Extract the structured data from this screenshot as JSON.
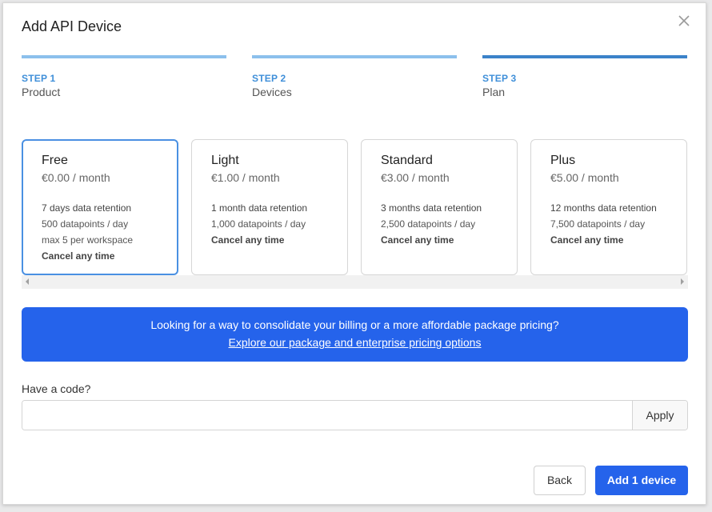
{
  "dialog": {
    "title": "Add API Device"
  },
  "steps": [
    {
      "num": "STEP 1",
      "name": "Product"
    },
    {
      "num": "STEP 2",
      "name": "Devices"
    },
    {
      "num": "STEP 3",
      "name": "Plan"
    }
  ],
  "plans": [
    {
      "name": "Free",
      "price": "€0.00 / month",
      "features": [
        "7 days data retention",
        "500 datapoints / day",
        "max 5 per workspace",
        "Cancel any time"
      ],
      "selected": true
    },
    {
      "name": "Light",
      "price": "€1.00 / month",
      "features": [
        "1 month data retention",
        "1,000 datapoints / day",
        "Cancel any time"
      ]
    },
    {
      "name": "Standard",
      "price": "€3.00 / month",
      "features": [
        "3 months data retention",
        "2,500 datapoints / day",
        "Cancel any time"
      ]
    },
    {
      "name": "Plus",
      "price": "€5.00 / month",
      "features": [
        "12 months data retention",
        "7,500 datapoints / day",
        "Cancel any time"
      ]
    }
  ],
  "banner": {
    "text": "Looking for a way to consolidate your billing or a more affordable package pricing?",
    "link": "Explore our package and enterprise pricing options"
  },
  "code": {
    "label": "Have a code?",
    "value": "",
    "placeholder": "",
    "apply_label": "Apply"
  },
  "footer": {
    "back_label": "Back",
    "add_label": "Add 1 device"
  },
  "colors": {
    "primary": "#2563eb",
    "step_active": "#3b82c9",
    "step_inactive": "#8cc0ec",
    "selected_border": "#4a90e2"
  }
}
